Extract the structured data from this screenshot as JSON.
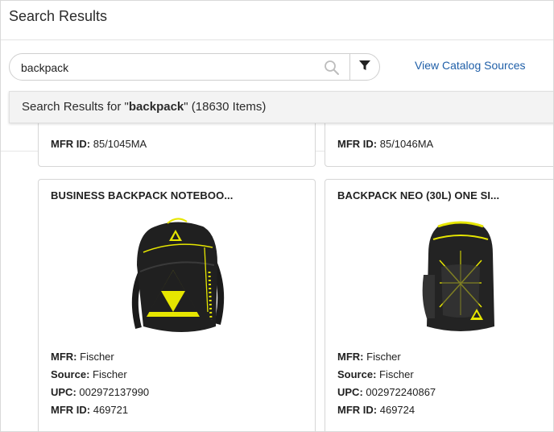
{
  "header": {
    "title": "Search Results"
  },
  "search": {
    "value": "backpack",
    "placeholder": ""
  },
  "catalog_link": "View Catalog Sources",
  "results_summary": {
    "prefix": "Search Results for \"",
    "query": "backpack",
    "suffix": "\" (18630 Items)"
  },
  "top_cards": [
    {
      "mfr_id_label": "MFR ID:",
      "mfr_id": "85/1045MA"
    },
    {
      "mfr_id_label": "MFR ID:",
      "mfr_id": "85/1046MA"
    }
  ],
  "products": [
    {
      "title": "BUSINESS BACKPACK NOTEBOO...",
      "image": "backpack-yellow-triangle-logo",
      "fields": [
        {
          "label": "MFR:",
          "value": "Fischer"
        },
        {
          "label": "Source:",
          "value": "Fischer"
        },
        {
          "label": "UPC:",
          "value": "002972137990"
        },
        {
          "label": "MFR ID:",
          "value": "469721"
        }
      ]
    },
    {
      "title": "BACKPACK NEO (30L) ONE SI...",
      "image": "backpack-neo-yellow-cord",
      "fields": [
        {
          "label": "MFR:",
          "value": "Fischer"
        },
        {
          "label": "Source:",
          "value": "Fischer"
        },
        {
          "label": "UPC:",
          "value": "002972240867"
        },
        {
          "label": "MFR ID:",
          "value": "469724"
        }
      ]
    }
  ],
  "colors": {
    "link": "#1f5fa8",
    "bar_bg": "#f3f3f3",
    "accent_yellow": "#e6e600"
  }
}
